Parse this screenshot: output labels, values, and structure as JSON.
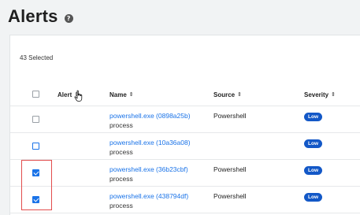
{
  "page": {
    "title": "Alerts",
    "help_icon": "question-icon"
  },
  "selection": {
    "count_label": "43 Selected"
  },
  "table": {
    "columns": [
      {
        "label": "Alert",
        "sort_icon": "sort-icon"
      },
      {
        "label": "Name",
        "sort_icon": "sort-icon"
      },
      {
        "label": "Source",
        "sort_icon": "sort-icon"
      },
      {
        "label": "Severity",
        "sort_icon": "sort-icon"
      }
    ],
    "rows": [
      {
        "checked": false,
        "name": "powershell.exe (0898a25b)",
        "type": "process",
        "source": "Powershell",
        "severity": "Low"
      },
      {
        "checked": false,
        "name": "powershell.exe (10a36a08)",
        "type": "process",
        "source": "",
        "severity": "Low"
      },
      {
        "checked": true,
        "name": "powershell.exe (36b23cbf)",
        "type": "process",
        "source": "Powershell",
        "severity": "Low"
      },
      {
        "checked": true,
        "name": "powershell.exe (438794df)",
        "type": "process",
        "source": "Powershell",
        "severity": "Low"
      }
    ]
  },
  "colors": {
    "link": "#1a73e8",
    "badge": "#1358c7",
    "highlight": "#e24c4c"
  }
}
